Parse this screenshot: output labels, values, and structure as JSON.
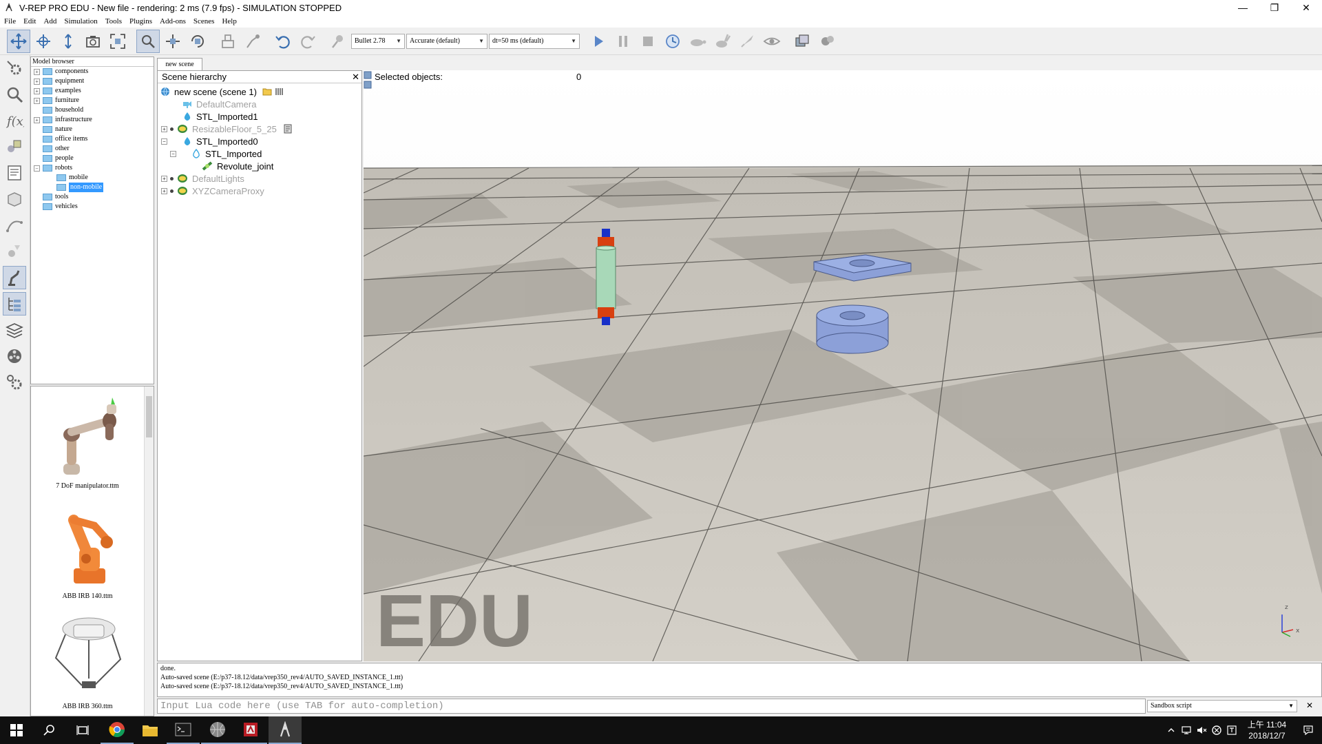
{
  "window": {
    "title": "V-REP PRO EDU - New file - rendering: 2 ms (7.9 fps) - SIMULATION STOPPED",
    "minimize": "—",
    "maximize": "❐",
    "close": "✕"
  },
  "menu": [
    "File",
    "Edit",
    "Add",
    "Simulation",
    "Tools",
    "Plugins",
    "Add-ons",
    "Scenes",
    "Help"
  ],
  "toolbar": {
    "engine": "Bullet 2.78",
    "accuracy": "Accurate (default)",
    "timestep": "dt=50 ms (default)"
  },
  "model_browser": {
    "header": "Model browser",
    "items": [
      {
        "label": "components",
        "level": 0,
        "expander": "+"
      },
      {
        "label": "equipment",
        "level": 0,
        "expander": "+"
      },
      {
        "label": "examples",
        "level": 0,
        "expander": "+"
      },
      {
        "label": "furniture",
        "level": 0,
        "expander": "+"
      },
      {
        "label": "household",
        "level": 0,
        "expander": ""
      },
      {
        "label": "infrastructure",
        "level": 0,
        "expander": "+"
      },
      {
        "label": "nature",
        "level": 0,
        "expander": ""
      },
      {
        "label": "office items",
        "level": 0,
        "expander": ""
      },
      {
        "label": "other",
        "level": 0,
        "expander": ""
      },
      {
        "label": "people",
        "level": 0,
        "expander": ""
      },
      {
        "label": "robots",
        "level": 0,
        "expander": "−"
      },
      {
        "label": "mobile",
        "level": 1,
        "expander": ""
      },
      {
        "label": "non-mobile",
        "level": 1,
        "expander": "",
        "selected": true
      },
      {
        "label": "tools",
        "level": 0,
        "expander": ""
      },
      {
        "label": "vehicles",
        "level": 0,
        "expander": ""
      }
    ]
  },
  "thumbnails": [
    {
      "caption": "7 DoF manipulator.ttm"
    },
    {
      "caption": "ABB IRB 140.ttm"
    },
    {
      "caption": "ABB IRB 360.ttm"
    }
  ],
  "scene_tab": "new scene",
  "hierarchy": {
    "header": "Scene hierarchy",
    "close": "✕",
    "root": "new scene (scene 1)",
    "rows": [
      {
        "label": "DefaultCamera",
        "gray": true
      },
      {
        "label": "STL_Imported1",
        "gray": false
      },
      {
        "label": "ResizableFloor_5_25",
        "gray": true
      },
      {
        "label": "STL_Imported0",
        "gray": false
      },
      {
        "label": "STL_Imported",
        "gray": false
      },
      {
        "label": "Revolute_joint",
        "gray": false
      },
      {
        "label": "DefaultLights",
        "gray": true
      },
      {
        "label": "XYZCameraProxy",
        "gray": true
      }
    ],
    "expanders": {
      "minus": "−",
      "plus": "+"
    }
  },
  "viewport": {
    "selected_label": "Selected objects:",
    "selected_count": "0",
    "watermark": "EDU",
    "axis": {
      "x": "x",
      "z": "z"
    }
  },
  "console": {
    "lines": [
      "done.",
      "Auto-saved scene (E:/p37-18.12/data/vrep350_rev4/AUTO_SAVED_INSTANCE_1.ttt)",
      "Auto-saved scene (E:/p37-18.12/data/vrep350_rev4/AUTO_SAVED_INSTANCE_1.ttt)"
    ],
    "input_placeholder": "Input Lua code here (use TAB for auto-completion)",
    "script_select": "Sandbox script",
    "close": "✕"
  },
  "taskbar": {
    "time": "上午 11:04",
    "date": "2018/12/7"
  },
  "colors": {
    "accent": "#3399ff",
    "title_bar": "#ffffff",
    "taskbar": "#101010",
    "floor_light": "#d8d4cc",
    "floor_dark": "#a8a49c",
    "object_blue": "#8ca0d8",
    "object_green": "#a8d8b8",
    "object_red": "#d04020"
  }
}
